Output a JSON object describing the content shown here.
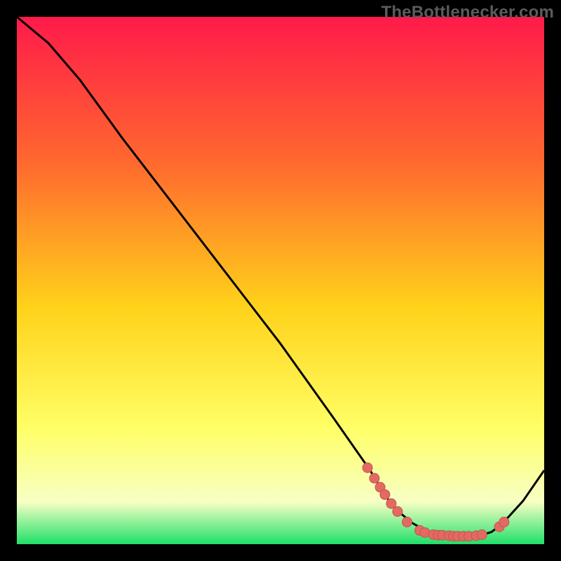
{
  "watermark": "TheBottlenecker.com",
  "colors": {
    "black": "#000000",
    "curve": "#000000",
    "marker_fill": "#e26a63",
    "marker_stroke": "#c7534d",
    "grad_top": "#ff1a4a",
    "grad_mid_upper": "#ff6a2e",
    "grad_mid": "#ffd21a",
    "grad_mid_lower": "#ffff66",
    "grad_pale": "#f7ffc4",
    "grad_green": "#1fe06a"
  },
  "chart_data": {
    "type": "line",
    "title": "",
    "xlabel": "",
    "ylabel": "",
    "xlim": [
      0,
      100
    ],
    "ylim": [
      0,
      100
    ],
    "series": [
      {
        "name": "curve",
        "x": [
          0,
          6,
          12,
          20,
          30,
          40,
          50,
          60,
          67,
          70,
          72,
          75,
          78,
          80,
          82,
          85,
          88,
          90,
          92,
          96,
          100
        ],
        "y": [
          100,
          95,
          88,
          77,
          64,
          51,
          38,
          24,
          14,
          9,
          6.5,
          4,
          2.3,
          1.8,
          1.6,
          1.5,
          1.7,
          2.3,
          3.8,
          8.2,
          14
        ]
      }
    ],
    "markers": [
      {
        "x": 66.5,
        "y": 14.5
      },
      {
        "x": 67.8,
        "y": 12.5
      },
      {
        "x": 68.9,
        "y": 10.8
      },
      {
        "x": 69.8,
        "y": 9.4
      },
      {
        "x": 71.0,
        "y": 7.7
      },
      {
        "x": 72.2,
        "y": 6.2
      },
      {
        "x": 74.0,
        "y": 4.2
      },
      {
        "x": 76.4,
        "y": 2.6
      },
      {
        "x": 77.4,
        "y": 2.2
      },
      {
        "x": 79.0,
        "y": 1.8
      },
      {
        "x": 79.9,
        "y": 1.7
      },
      {
        "x": 80.7,
        "y": 1.7
      },
      {
        "x": 82.0,
        "y": 1.6
      },
      {
        "x": 82.8,
        "y": 1.5
      },
      {
        "x": 83.6,
        "y": 1.5
      },
      {
        "x": 84.7,
        "y": 1.5
      },
      {
        "x": 85.7,
        "y": 1.5
      },
      {
        "x": 87.1,
        "y": 1.6
      },
      {
        "x": 88.2,
        "y": 1.8
      },
      {
        "x": 91.5,
        "y": 3.3
      },
      {
        "x": 92.4,
        "y": 4.2
      }
    ]
  }
}
